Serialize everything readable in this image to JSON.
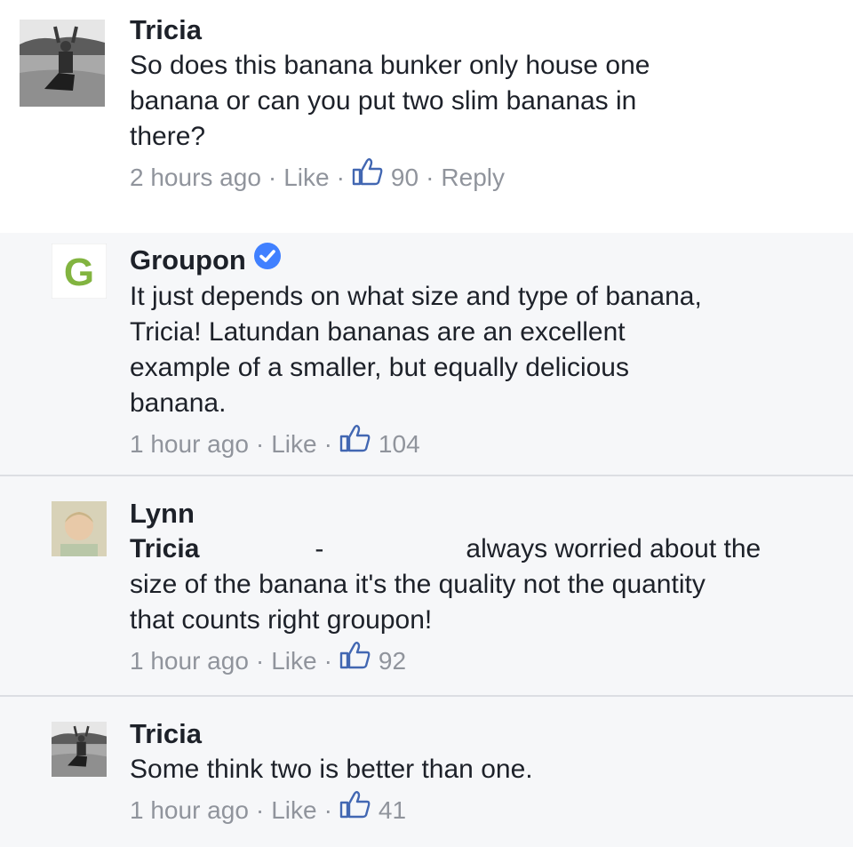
{
  "comments": [
    {
      "author": "Tricia",
      "text": "So does this banana bunker only house one\nbanana or can you put two slim bananas in\nthere?",
      "time": "2 hours ago",
      "like_label": "Like",
      "likes": "90",
      "reply_label": "Reply",
      "avatar": "person-kneeling-photo"
    },
    {
      "author": "Groupon",
      "verified": true,
      "text": "It just depends on what size and type of banana,\nTricia! Latundan bananas are an excellent\nexample of a smaller, but equally delicious\nbanana.",
      "time": "1 hour ago",
      "like_label": "Like",
      "likes": "104",
      "avatar_letter": "G",
      "brand_color": "#82b440"
    },
    {
      "author": "Lynn",
      "mention": "Tricia",
      "mention_dash": "-",
      "text_line1": "always worried about the",
      "text_rest": "size of the banana it's the quality not the quantity\nthat counts right groupon!",
      "time": "1 hour ago",
      "like_label": "Like",
      "likes": "92",
      "avatar": "child-photo"
    },
    {
      "author": "Tricia",
      "text": "Some think two is better than one.",
      "time": "1 hour ago",
      "like_label": "Like",
      "likes": "41",
      "avatar": "person-kneeling-photo"
    }
  ],
  "colors": {
    "text": "#1d2129",
    "meta": "#90949c",
    "verified": "#4080ff",
    "shade": "#f6f7f9",
    "like_icon": "#4267b2"
  }
}
